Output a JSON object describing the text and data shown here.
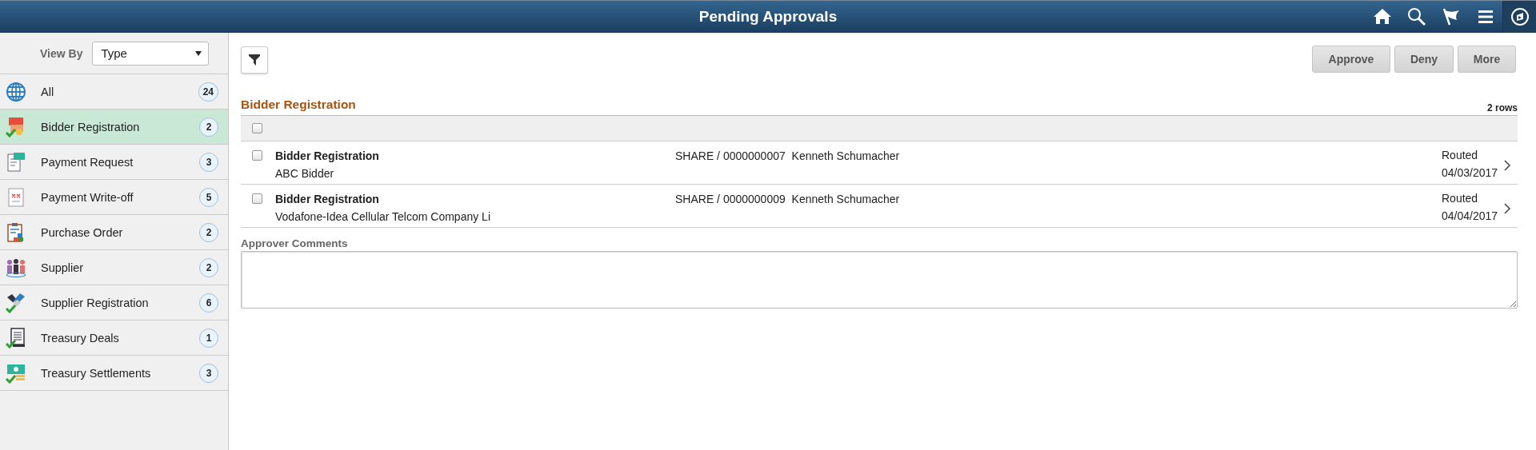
{
  "header": {
    "title": "Pending Approvals"
  },
  "sidebar": {
    "view_by": {
      "label": "View By",
      "value": "Type"
    },
    "items": [
      {
        "label": "All",
        "count": "24",
        "selected": false
      },
      {
        "label": "Bidder Registration",
        "count": "2",
        "selected": true
      },
      {
        "label": "Payment Request",
        "count": "3",
        "selected": false
      },
      {
        "label": "Payment Write-off",
        "count": "5",
        "selected": false
      },
      {
        "label": "Purchase Order",
        "count": "2",
        "selected": false
      },
      {
        "label": "Supplier",
        "count": "2",
        "selected": false
      },
      {
        "label": "Supplier Registration",
        "count": "6",
        "selected": false
      },
      {
        "label": "Treasury Deals",
        "count": "1",
        "selected": false
      },
      {
        "label": "Treasury Settlements",
        "count": "3",
        "selected": false
      }
    ]
  },
  "actions": [
    "Approve",
    "Deny",
    "More"
  ],
  "grid": {
    "title": "Bidder Registration",
    "row_count": "2 rows",
    "select_all": false,
    "rows": [
      {
        "checked": false,
        "title": "Bidder Registration",
        "subtitle": "ABC Bidder",
        "reference": "SHARE / 0000000007  Kenneth Schumacher",
        "status": "Routed",
        "date": "04/03/2017"
      },
      {
        "checked": false,
        "title": "Bidder Registration",
        "subtitle": "Vodafone-Idea Cellular Telcom Company Li",
        "reference": "SHARE / 0000000009  Kenneth Schumacher",
        "status": "Routed",
        "date": "04/04/2017"
      }
    ]
  },
  "comments": {
    "label": "Approver Comments"
  }
}
